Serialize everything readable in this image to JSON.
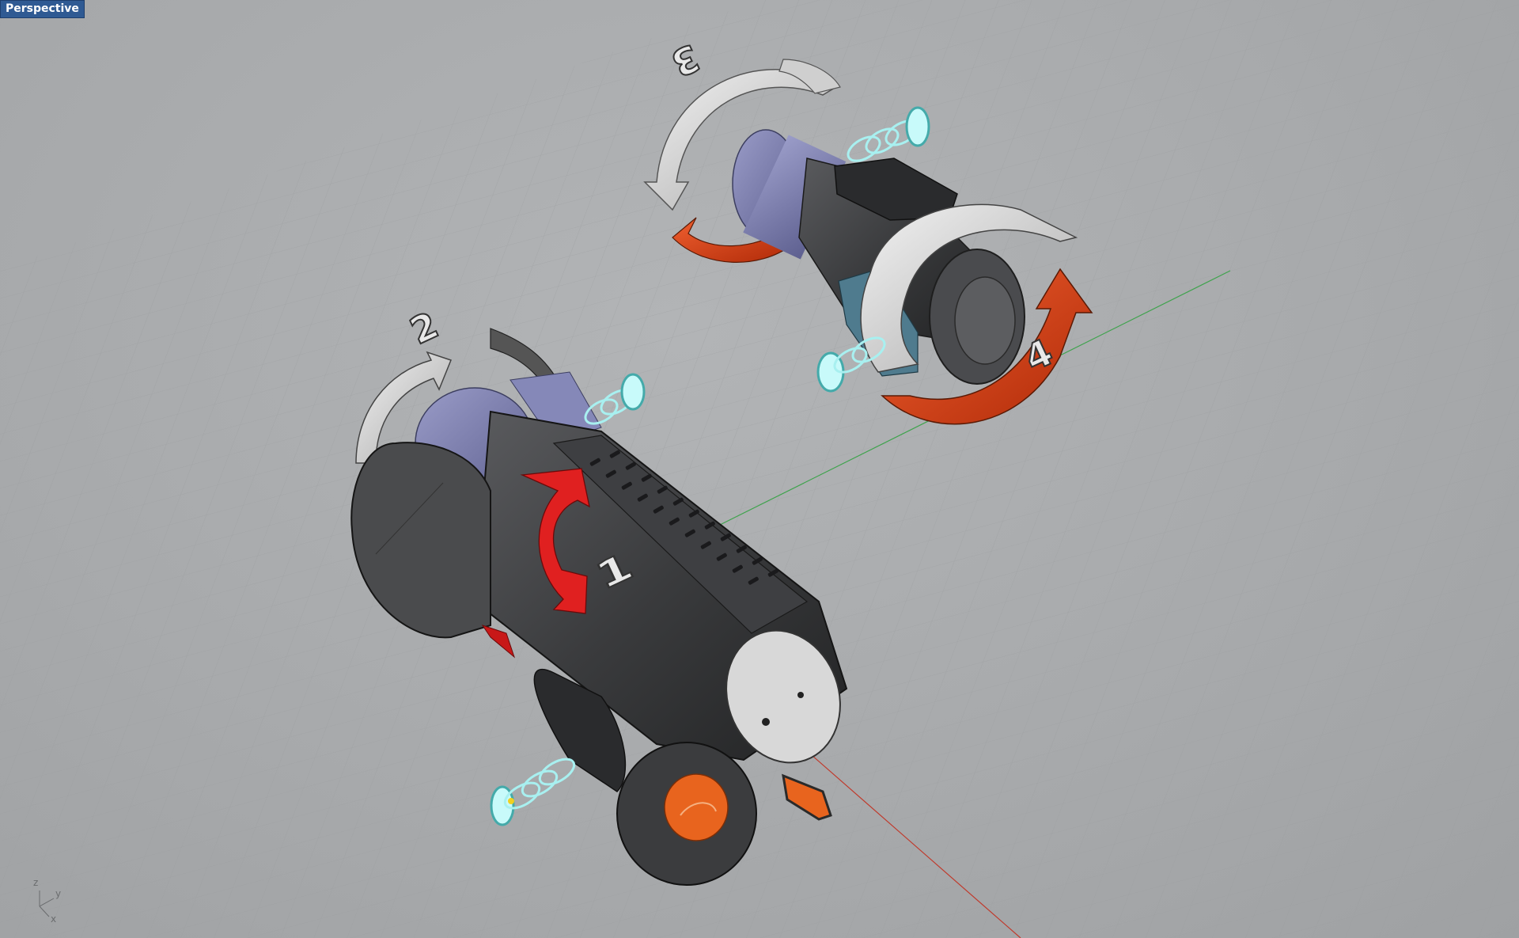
{
  "viewport": {
    "label": "Perspective",
    "label_bg": "#2f5a93"
  },
  "step_labels": [
    "1",
    "2",
    "3",
    "4"
  ],
  "axis_indicator": {
    "z": "z",
    "y": "y",
    "x": "x"
  },
  "colors": {
    "background": "#a9abad",
    "grid_line": "#9c9ea0",
    "axis_x": "#c0392b",
    "axis_y": "#3fa34d",
    "body_dark": "#3a3b3d",
    "body_purple": "#7a7ca8",
    "arrow_red": "#d8401a",
    "arrow_silver": "#d6d6d6",
    "lens_cyan": "#a8f0f0",
    "cap_orange": "#e8641e"
  },
  "icons": [
    "viewport-axis-icon",
    "rotate-arrow-icon",
    "spring-icon"
  ]
}
